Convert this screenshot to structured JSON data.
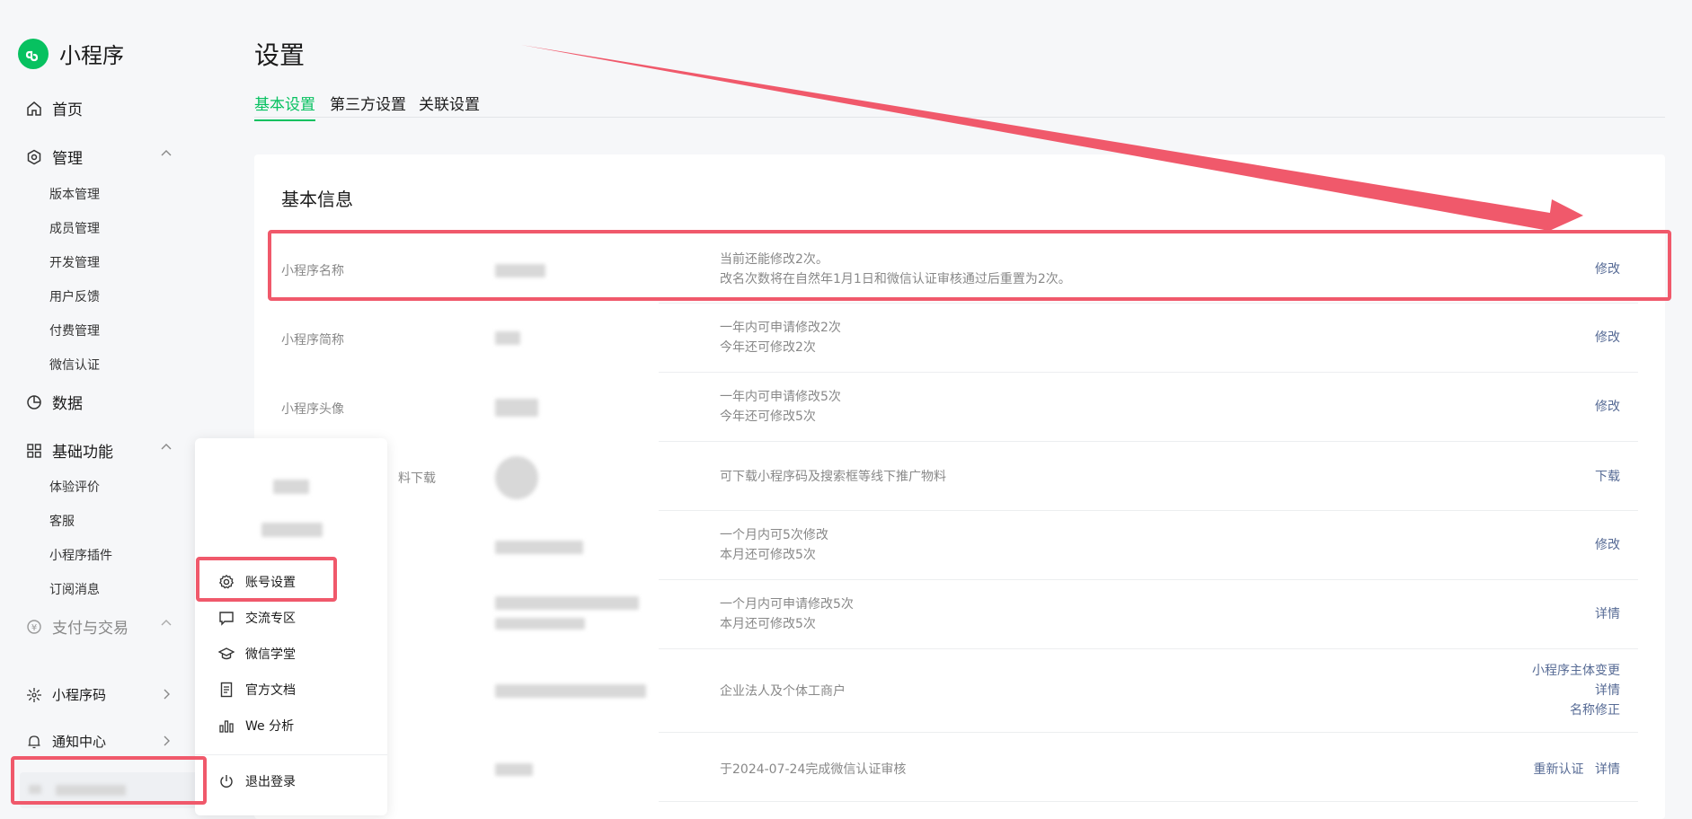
{
  "app": {
    "name": "小程序"
  },
  "sidebar": {
    "home": "首页",
    "manage": "管理",
    "manage_items": [
      "版本管理",
      "成员管理",
      "开发管理",
      "用户反馈",
      "付费管理",
      "微信认证"
    ],
    "data": "数据",
    "basic": "基础功能",
    "basic_items": [
      "体验评价",
      "客服",
      "小程序插件",
      "订阅消息"
    ],
    "pay": "支付与交易",
    "qrcode": "小程序码",
    "notify": "通知中心"
  },
  "page": {
    "title": "设置",
    "tabs": [
      "基本设置",
      "第三方设置",
      "关联设置"
    ],
    "active_tab": "基本设置"
  },
  "card": {
    "title": "基本信息",
    "rows": [
      {
        "label": "小程序名称",
        "desc": [
          "当前还能修改2次。",
          "改名次数将在自然年1月1日和微信认证审核通过后重置为2次。"
        ],
        "actions": [
          "修改"
        ]
      },
      {
        "label": "小程序简称",
        "desc": [
          "一年内可申请修改2次",
          "今年还可修改2次"
        ],
        "actions": [
          "修改"
        ]
      },
      {
        "label": "小程序头像",
        "desc": [
          "一年内可申请修改5次",
          "今年还可修改5次"
        ],
        "actions": [
          "修改"
        ]
      },
      {
        "label": "料下载",
        "desc": [
          "可下载小程序码及搜索框等线下推广物料"
        ],
        "actions": [
          "下载"
        ]
      },
      {
        "label": "",
        "desc": [
          "一个月内可5次修改",
          "本月还可修改5次"
        ],
        "actions": [
          "修改"
        ]
      },
      {
        "label": "",
        "desc": [
          "一个月内可申请修改5次",
          "本月还可修改5次"
        ],
        "actions": [
          "详情"
        ]
      },
      {
        "label": "",
        "desc": [
          "企业法人及个体工商户"
        ],
        "actions": [
          "小程序主体变更",
          "详情",
          "名称修正"
        ]
      },
      {
        "label": "",
        "desc": [
          "于2024-07-24完成微信认证审核"
        ],
        "actions": [
          "重新认证",
          "详情"
        ]
      }
    ]
  },
  "popup": {
    "items": [
      "账号设置",
      "交流专区",
      "微信学堂",
      "官方文档",
      "We 分析"
    ],
    "logout": "退出登录"
  },
  "colors": {
    "brand": "#07c160",
    "link": "#576b95",
    "annotation": "#f0596b"
  }
}
